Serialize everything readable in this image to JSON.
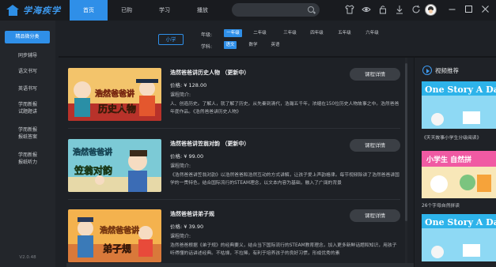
{
  "app": {
    "logo_text": "学海疾学"
  },
  "nav": {
    "items": [
      "首页",
      "已购",
      "学习",
      "播放"
    ],
    "active": 0
  },
  "search": {
    "placeholder": ""
  },
  "toolbar_icons": [
    "shirt-icon",
    "eye-icon",
    "lock-icon",
    "download-icon",
    "refresh-icon"
  ],
  "window_controls": [
    "minimize-icon",
    "restore-icon",
    "close-icon"
  ],
  "sidebar": {
    "items": [
      "精品微分类",
      "同步辅导",
      "语文书写",
      "英语书写",
      "学而新报\n试题题讲",
      "学而新报\n报纸答案",
      "学而新报\n报纸听力"
    ],
    "active": 0,
    "version": "V2.0.48"
  },
  "filter": {
    "level_pill": "小学",
    "grade_label": "年级:",
    "grades": [
      "一年级",
      "二年级",
      "三年级",
      "四年级",
      "五年级",
      "六年级"
    ],
    "grade_active": 0,
    "subject_label": "学科:",
    "subjects": [
      "语文",
      "数学",
      "英语"
    ],
    "subject_active": 0
  },
  "courses": [
    {
      "title": "浩然爸爸讲历史人物 （更新中）",
      "price_label": "价格:",
      "price": "¥ 128.00",
      "intro_label": "课程简介:",
      "desc": "人、创造历史。了解人，就了解了历史。从先秦到清代，浩瀚五千年，浓缩在150位历史人物故事之中。浩然爸爸年度作品。《浩然爸爸讲历史人物》",
      "button": "课程详情",
      "thumb_text": [
        "浩然爸爸讲",
        "历史人物"
      ]
    },
    {
      "title": "浩然爸爸讲笠翁对韵 （更新中）",
      "price_label": "价格:",
      "price": "¥ 99.00",
      "intro_label": "课程简介:",
      "desc": "《浩然爸爸讲笠翁对韵》以浩然爸爸和浩然互动的方式讲解，让孩子爱上声韵格律。每节视频除讲了浩然爸爸讲国学的一贯特色，结合国际流行的STEAM理念，以文本内容为基础，融入了广阔的背景",
      "button": "课程详情",
      "thumb_text": [
        "浩然爸爸讲",
        "笠翁对韵"
      ]
    },
    {
      "title": "浩然爸爸讲弟子规",
      "price_label": "价格:",
      "price": "¥ 39.90",
      "intro_label": "课程简介:",
      "desc": "浩然爸爸根据《弟子规》的经典要义，结合当下国际流行的STEAM教育理念，加入更多新鲜话题和知识，用孩子听得懂的话讲述经典。不枯燥，不拉稀，有利于培养孩子的良好习惯，形成优秀的素",
      "button": "课程详情",
      "thumb_text": [
        "浩然爸爸讲",
        "弟子规"
      ]
    }
  ],
  "right_panel": {
    "title": "视频推荐",
    "videos": [
      {
        "banner": "One Story A Da",
        "caption": "《天天故事小学生分级阅读》"
      },
      {
        "banner": "小学生 自然拼",
        "caption": "26个字母自然拼读"
      },
      {
        "banner": "One Story A Da",
        "caption": ""
      }
    ]
  },
  "colors": {
    "accent": "#2f8fe8",
    "bg": "#1e2126",
    "topbar": "#191b1f",
    "sidebar": "#23262b",
    "button": "#3b3f45"
  }
}
